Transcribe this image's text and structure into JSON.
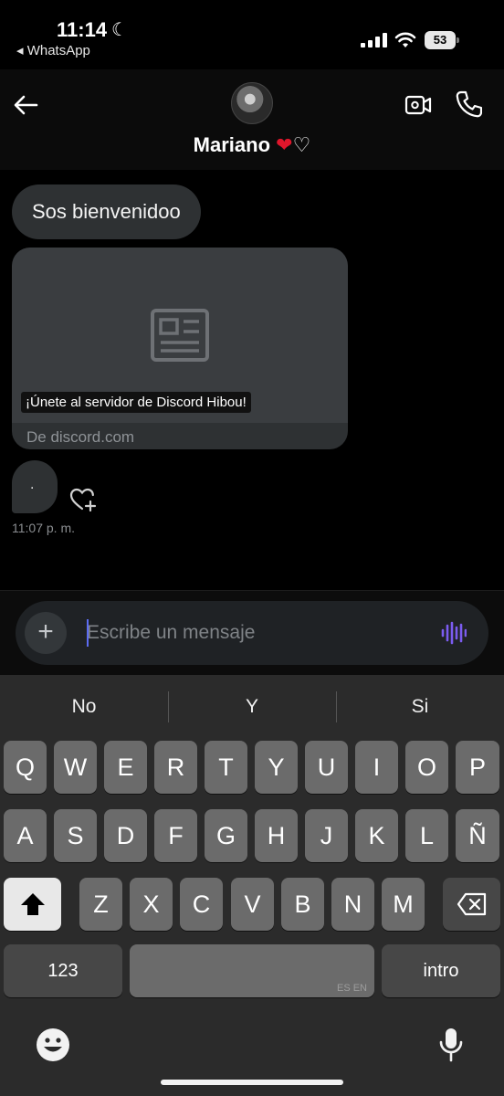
{
  "status_bar": {
    "time": "11:14",
    "back_app": "◂ WhatsApp",
    "battery": "53"
  },
  "header": {
    "contact_name": "Mariano",
    "icons": [
      "back-arrow-icon",
      "avatar",
      "video-call-icon",
      "phone-icon"
    ]
  },
  "messages": {
    "text_bubble": "Sos bienvenidoo",
    "link_card": {
      "caption": "¡Únete al servidor de Discord Hibou!",
      "domain": "De discord.com"
    },
    "dot_bubble": ".",
    "timestamp": "11:07 p. m."
  },
  "composer": {
    "placeholder": "Escribe un mensaje"
  },
  "keyboard": {
    "suggestions": [
      "No",
      "Y",
      "Si"
    ],
    "row1": [
      "Q",
      "W",
      "E",
      "R",
      "T",
      "Y",
      "U",
      "I",
      "O",
      "P"
    ],
    "row2": [
      "A",
      "S",
      "D",
      "F",
      "G",
      "H",
      "J",
      "K",
      "L",
      "Ñ"
    ],
    "row3": [
      "Z",
      "X",
      "C",
      "V",
      "B",
      "N",
      "M"
    ],
    "numbers_label": "123",
    "space_tag": "ES EN",
    "return_label": "intro"
  },
  "colors": {
    "background": "#000000",
    "bubble": "#2e3133",
    "heart_red": "#e0162b",
    "accent_purple": "#7b5cf0",
    "keyboard_bg": "#2b2b2b",
    "key": "#6b6b6b"
  }
}
